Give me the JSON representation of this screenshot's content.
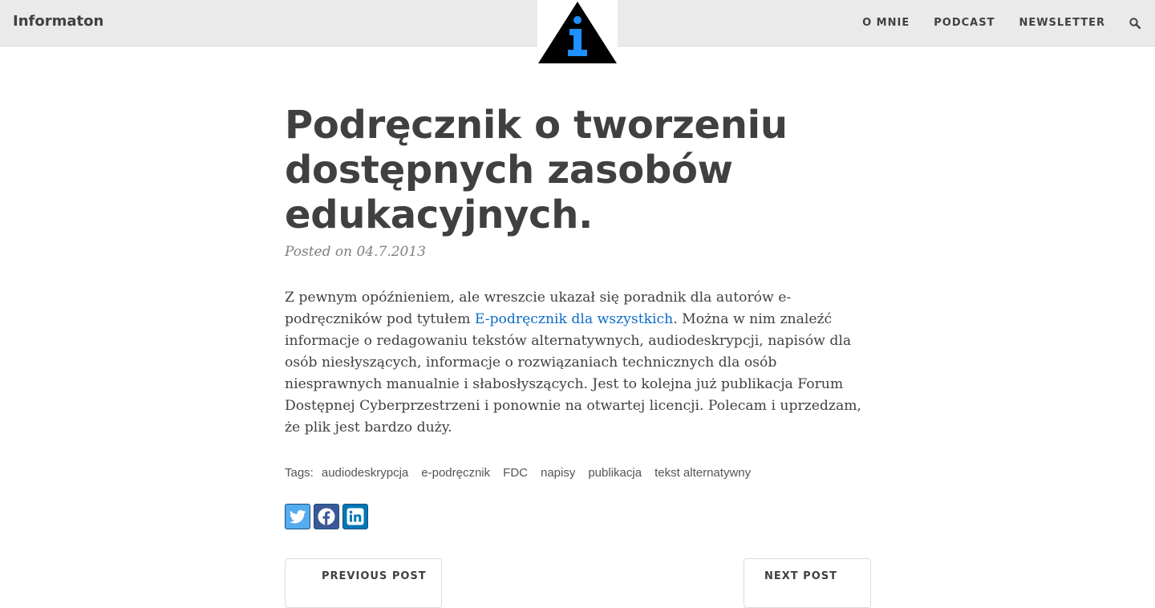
{
  "header": {
    "brand": "Informaton",
    "nav": [
      "O MNIE",
      "PODCAST",
      "NEWSLETTER"
    ],
    "search_icon": "search-icon",
    "logo_icon": "info-triangle-logo",
    "colors": {
      "bar_bg": "#eaeaea",
      "logo_accent": "#1e90ff",
      "text": "#404040"
    }
  },
  "post": {
    "title": "Podręcznik o tworzeniu dostępnych zasobów edukacyjnych.",
    "meta": "Posted on 04.7.2013",
    "body": {
      "before_link": "Z pewnym opóźnieniem, ale wreszcie ukazał się poradnik dla autorów e-podręczników pod tytułem ",
      "link_text": "E-podręcznik dla wszystkich",
      "after_link": ". Można w nim znaleźć informacje o redagowaniu tekstów alternatywnych, audiodeskrypcji, napisów dla osób niesłyszących, informacje o rozwiązaniach technicznych dla osób niesprawnych manualnie i słabosłyszących. Jest to kolejna już publikacja Forum Dostępnej Cyberprzestrzeni i ponownie na otwartej licencji. Polecam i uprzedzam, że plik jest bardzo duży."
    },
    "tags_label": "Tags:",
    "tags": [
      "audiodeskrypcja",
      "e-podręcznik",
      "FDC",
      "napisy",
      "publikacja",
      "tekst alternatywny"
    ],
    "share": [
      "twitter-icon",
      "facebook-icon",
      "linkedin-icon"
    ],
    "link_color": "#0b6cc7"
  },
  "pager": {
    "previous": "PREVIOUS POST",
    "next": "NEXT POST"
  }
}
